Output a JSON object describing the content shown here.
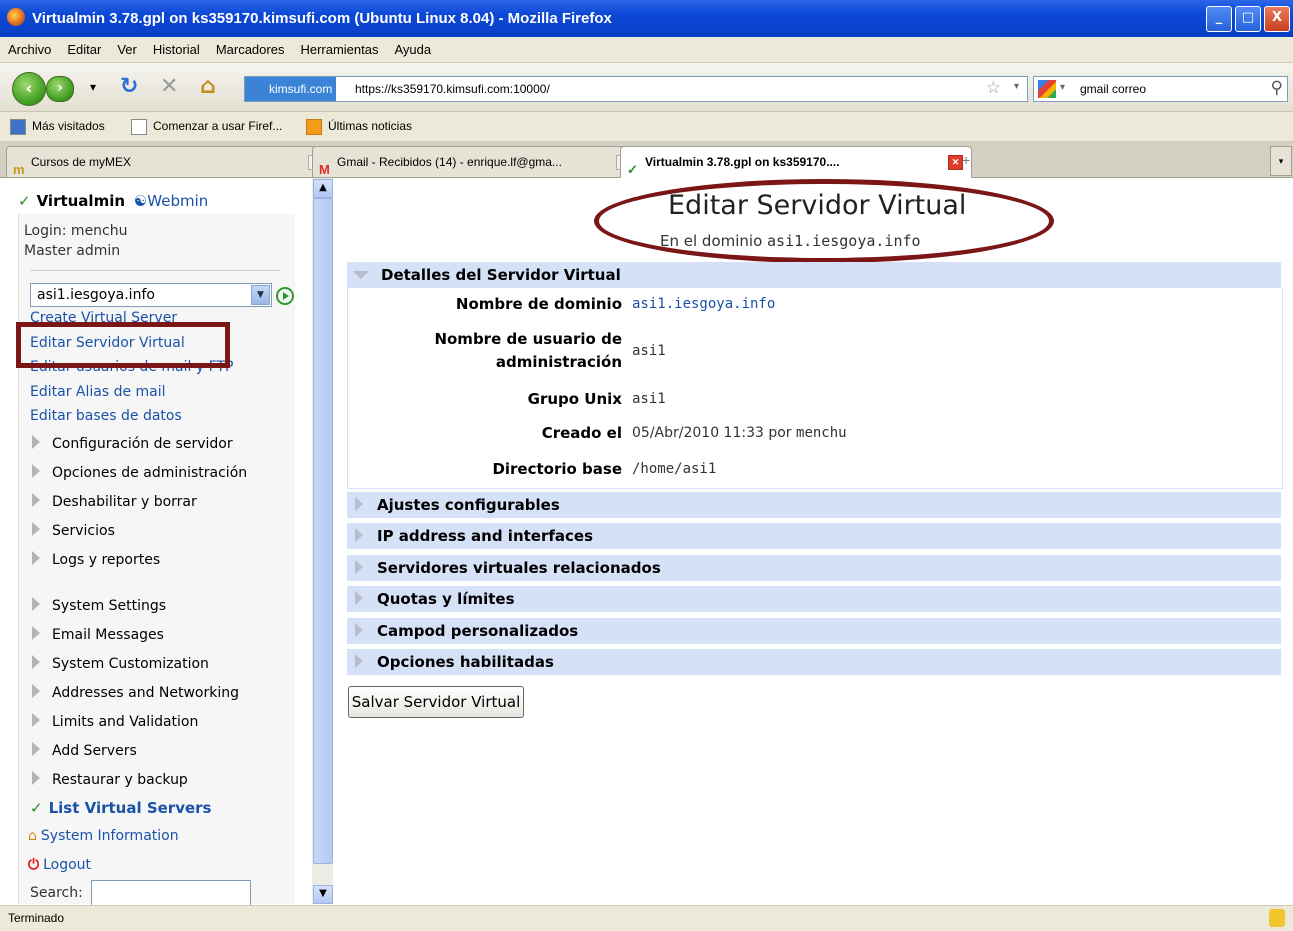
{
  "window": {
    "title": "Virtualmin 3.78.gpl on ks359170.kimsufi.com (Ubuntu Linux 8.04) - Mozilla Firefox",
    "buttons": [
      "_",
      "□",
      "X"
    ]
  },
  "menu": [
    "Archivo",
    "Editar",
    "Ver",
    "Historial",
    "Marcadores",
    "Herramientas",
    "Ayuda"
  ],
  "nav": {
    "site_label": "kimsufi.com",
    "url": "https://ks359170.kimsufi.com:10000/",
    "search_value": "gmail correo"
  },
  "bookmarks": [
    "Más visitados",
    "Comenzar a usar Firef...",
    "Últimas noticias"
  ],
  "tabs": [
    {
      "label": "Cursos de myMEX",
      "active": false
    },
    {
      "label": "Gmail - Recibidos (14) - enrique.lf@gma...",
      "active": false
    },
    {
      "label": "Virtualmin 3.78.gpl on ks359170....",
      "active": true
    }
  ],
  "sidebar": {
    "brand": "Virtualmin",
    "webmin": "Webmin",
    "login": "Login: menchu",
    "role": "Master admin",
    "domain_select": "asi1.iesgoya.info",
    "links": [
      "Create Virtual Server",
      "Editar Servidor Virtual",
      "Editar usuarios de mail y FTP",
      "Editar Alias de mail",
      "Editar bases de datos"
    ],
    "groups1": [
      "Configuración de servidor",
      "Opciones de administración",
      "Deshabilitar y borrar",
      "Servicios",
      "Logs y reportes"
    ],
    "groups2": [
      "System Settings",
      "Email Messages",
      "System Customization",
      "Addresses and Networking",
      "Limits and Validation",
      "Add Servers",
      "Restaurar y backup"
    ],
    "list_servers": "List Virtual Servers",
    "system_info": "System Information",
    "logout": "Logout",
    "search_label": "Search:"
  },
  "main": {
    "title": "Editar Servidor Virtual",
    "subtitle_prefix": "En el dominio",
    "subtitle_domain": "asi1.iesgoya.info",
    "details_header": "Detalles del Servidor Virtual",
    "fields": {
      "domain_label": "Nombre de dominio",
      "domain_value": "asi1.iesgoya.info",
      "user_label_1": "Nombre de usuario de",
      "user_label_2": "administración",
      "user_value": "asi1",
      "group_label": "Grupo Unix",
      "group_value": "asi1",
      "created_label": "Creado el",
      "created_value": "05/Abr/2010 11:33 por",
      "created_by": "menchu",
      "home_label": "Directorio base",
      "home_value": "/home/asi1"
    },
    "sections": [
      "Ajustes configurables",
      "IP address and interfaces",
      "Servidores virtuales relacionados",
      "Quotas y límites",
      "Campod personalizados",
      "Opciones habilitadas"
    ],
    "save_button": "Salvar Servidor Virtual"
  },
  "status": "Terminado",
  "colors": {
    "highlight": "#7a1616",
    "section": "#d5e1f7",
    "link": "#1a52a8"
  }
}
